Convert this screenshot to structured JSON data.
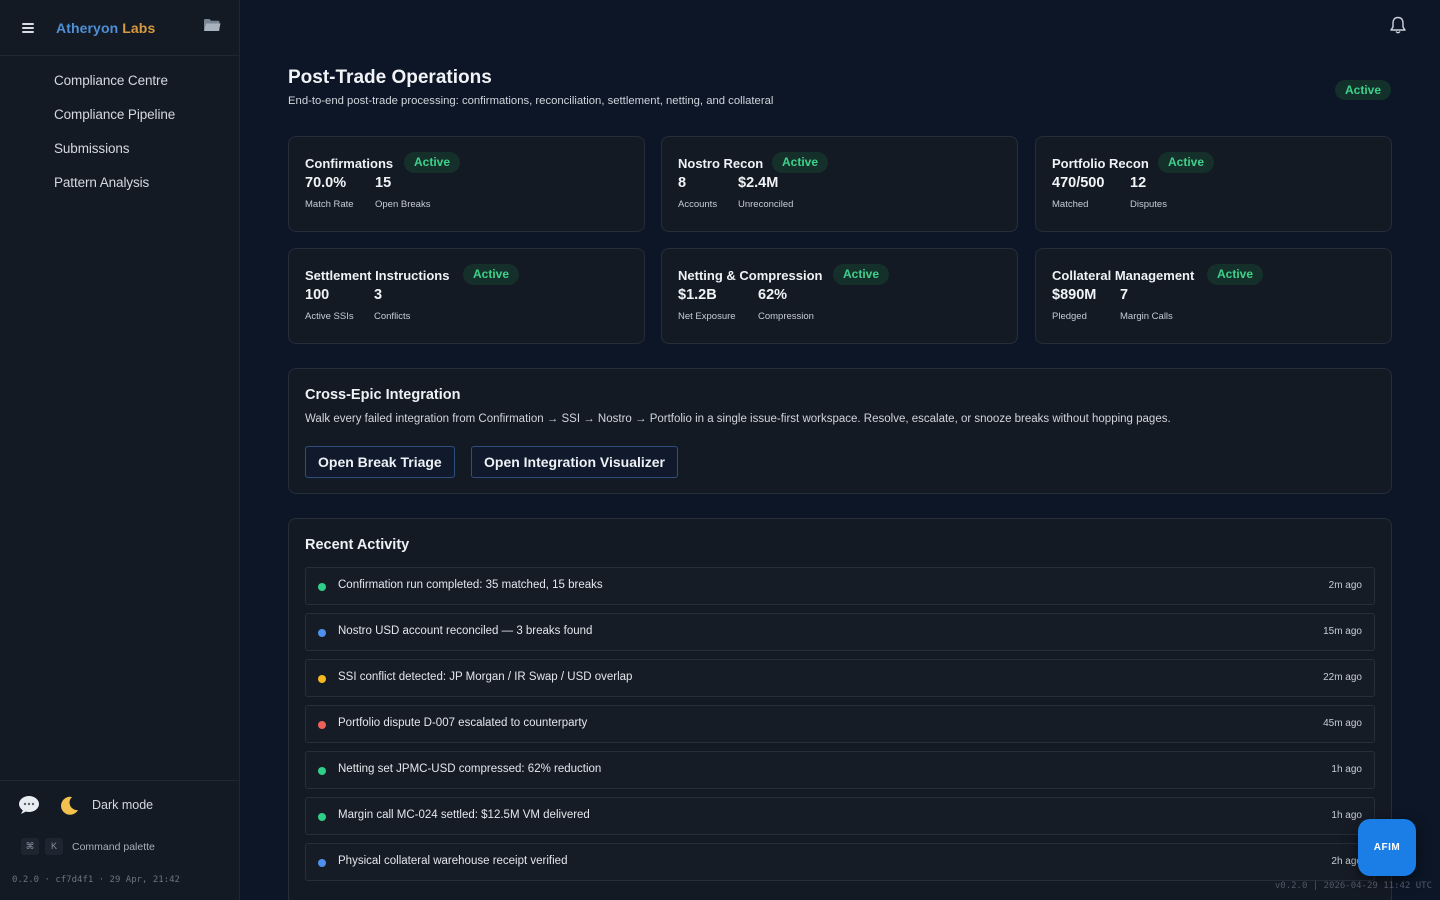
{
  "sidebar": {
    "brand_part1": "Atheryon",
    "brand_part2": "Labs",
    "nav": [
      {
        "label": "Compliance Centre"
      },
      {
        "label": "Compliance Pipeline"
      },
      {
        "label": "Submissions"
      },
      {
        "label": "Pattern Analysis"
      }
    ],
    "dark_mode_label": "Dark mode",
    "kbd_mod": "⌘",
    "kbd_key": "K",
    "command_palette_label": "Command palette",
    "version": "0.2.0 · cf7d4f1 · 29 Apr, 21:42"
  },
  "header": {
    "title": "Post-Trade Operations",
    "subtitle": "End-to-end post-trade processing: confirmations, reconciliation, settlement, netting, and collateral",
    "status": "Active"
  },
  "cards": [
    {
      "title": "Confirmations",
      "status": "Active",
      "m1_value": "70.0%",
      "m1_label": "Match Rate",
      "m2_value": "15",
      "m2_label": "Open Breaks"
    },
    {
      "title": "Nostro Recon",
      "status": "Active",
      "m1_value": "8",
      "m1_label": "Accounts",
      "m2_value": "$2.4M",
      "m2_label": "Unreconciled"
    },
    {
      "title": "Portfolio Recon",
      "status": "Active",
      "m1_value": "470/500",
      "m1_label": "Matched",
      "m2_value": "12",
      "m2_label": "Disputes"
    },
    {
      "title": "Settlement Instructions",
      "status": "Active",
      "m1_value": "100",
      "m1_label": "Active SSIs",
      "m2_value": "3",
      "m2_label": "Conflicts"
    },
    {
      "title": "Netting & Compression",
      "status": "Active",
      "m1_value": "$1.2B",
      "m1_label": "Net Exposure",
      "m2_value": "62%",
      "m2_label": "Compression"
    },
    {
      "title": "Collateral Management",
      "status": "Active",
      "m1_value": "$890M",
      "m1_label": "Pledged",
      "m2_value": "7",
      "m2_label": "Margin Calls"
    }
  ],
  "integration": {
    "title": "Cross-Epic Integration",
    "description": "Walk every failed integration from Confirmation → SSI → Nostro → Portfolio in a single issue-first workspace. Resolve, escalate, or snooze breaks without hopping pages.",
    "button1": "Open Break Triage",
    "button2": "Open Integration Visualizer"
  },
  "activity": {
    "title": "Recent Activity",
    "items": [
      {
        "text": "Confirmation run completed: 35 matched, 15 breaks",
        "time": "2m ago",
        "color": "#2ecf86"
      },
      {
        "text": "Nostro USD account reconciled — 3 breaks found",
        "time": "15m ago",
        "color": "#4f8ff0"
      },
      {
        "text": "SSI conflict detected: JP Morgan / IR Swap / USD overlap",
        "time": "22m ago",
        "color": "#f5b820"
      },
      {
        "text": "Portfolio dispute D-007 escalated to counterparty",
        "time": "45m ago",
        "color": "#f0605a"
      },
      {
        "text": "Netting set JPMC-USD compressed: 62% reduction",
        "time": "1h ago",
        "color": "#2ecf86"
      },
      {
        "text": "Margin call MC-024 settled: $12.5M VM delivered",
        "time": "1h ago",
        "color": "#2ecf86"
      },
      {
        "text": "Physical collateral warehouse receipt verified",
        "time": "2h ago",
        "color": "#4f8ff0"
      }
    ]
  },
  "fab_label": "AFIM",
  "build_info": "v0.2.0 | 2026-04-29 11:42 UTC",
  "icons": {
    "menu": "hamburger-icon",
    "folder": "folder-icon",
    "bell": "bell-icon",
    "chat": "chat-bubble-icon",
    "moon": "moon-icon"
  }
}
